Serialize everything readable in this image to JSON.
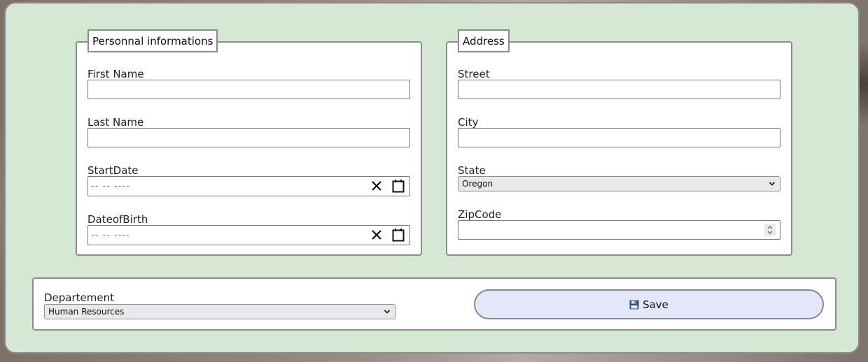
{
  "personal": {
    "legend": "Personnal informations",
    "first_name_label": "First Name",
    "first_name_value": "",
    "last_name_label": "Last Name",
    "last_name_value": "",
    "start_date_label": "StartDate",
    "start_date_placeholder": "-- -- ----",
    "dob_label": "DateofBirth",
    "dob_placeholder": "-- -- ----"
  },
  "address": {
    "legend": "Address",
    "street_label": "Street",
    "street_value": "",
    "city_label": "City",
    "city_value": "",
    "state_label": "State",
    "state_selected": "Oregon",
    "zip_label": "ZipCode",
    "zip_value": ""
  },
  "footer": {
    "department_label": "Departement",
    "department_selected": "Human Resources",
    "save_label": "Save"
  },
  "icons": {
    "clear": "close-icon",
    "calendar": "calendar-icon",
    "chevron": "chevron-down-icon",
    "spinner": "spinner-icon",
    "save": "floppy-disk-icon"
  },
  "colors": {
    "panel_bg": "#d5e8d4",
    "save_button_bg": "#e4e6fa",
    "save_icon": "#2a4f8f"
  }
}
